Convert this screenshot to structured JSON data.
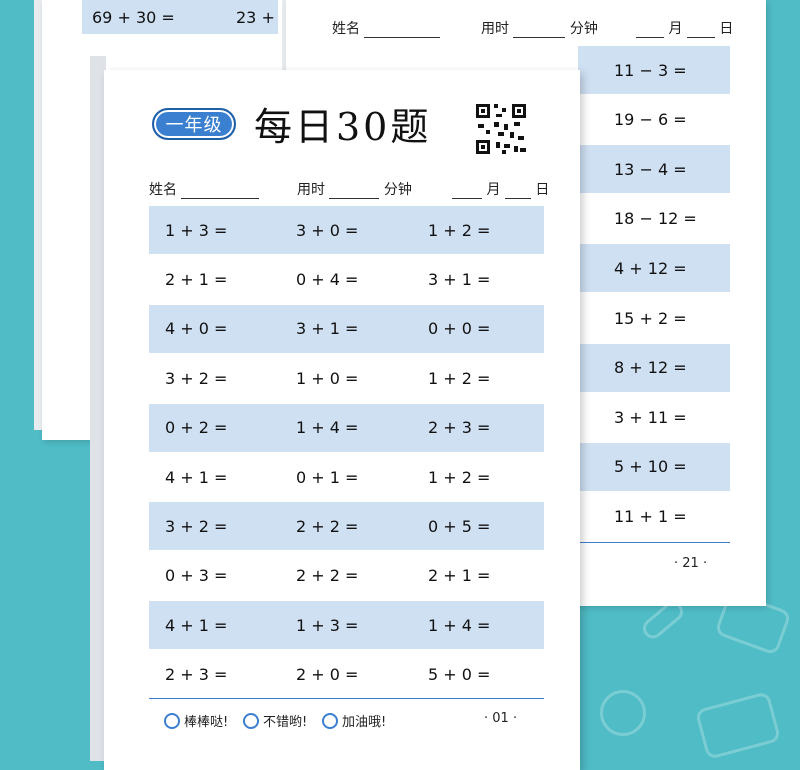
{
  "back_left": {
    "rows": [
      [
        "69 + 30 =",
        "23 +"
      ]
    ]
  },
  "back_right": {
    "header": {
      "name": "姓名",
      "time": "用时",
      "minute": "分钟",
      "month": "月",
      "day": "日"
    },
    "problems": [
      "11 − 3 =",
      "19 − 6 =",
      "13 − 4 =",
      "18 − 12 =",
      "4 + 12 =",
      "15 + 2 =",
      "8 + 12 =",
      "3 + 11 =",
      "5 + 10 =",
      "11 + 1 ="
    ],
    "page_number": "· 21 ·"
  },
  "front": {
    "grade": "一年级",
    "title": "每日30题",
    "header": {
      "name": "姓名",
      "time": "用时",
      "minute": "分钟",
      "month": "月",
      "day": "日"
    },
    "rows": [
      [
        "1 + 3 =",
        "3 + 0 =",
        "1 + 2 ="
      ],
      [
        "2 + 1 =",
        "0 + 4 =",
        "3 + 1 ="
      ],
      [
        "4 + 0 =",
        "3 + 1 =",
        "0 + 0 ="
      ],
      [
        "3 + 2 =",
        "1 + 0 =",
        "1 + 2 ="
      ],
      [
        "0 + 2 =",
        "1 + 4 =",
        "2 + 3 ="
      ],
      [
        "4 + 1 =",
        "0 + 1 =",
        "1 + 2 ="
      ],
      [
        "3 + 2 =",
        "2 + 2 =",
        "0 + 5 ="
      ],
      [
        "0 + 3 =",
        "2 + 2 =",
        "2 + 1 ="
      ],
      [
        "4 + 1 =",
        "1 + 3 =",
        "1 + 4 ="
      ],
      [
        "2 + 3 =",
        "2 + 0 =",
        "5 + 0 ="
      ]
    ],
    "footer": {
      "opt1": "棒棒哒!",
      "opt2": "不错哟!",
      "opt3": "加油哦!",
      "page_number": "· 01 ·"
    }
  },
  "colors": {
    "background": "#4fbcc6",
    "row_shade": "#cfe0f3",
    "accent": "#3a7fd0"
  }
}
